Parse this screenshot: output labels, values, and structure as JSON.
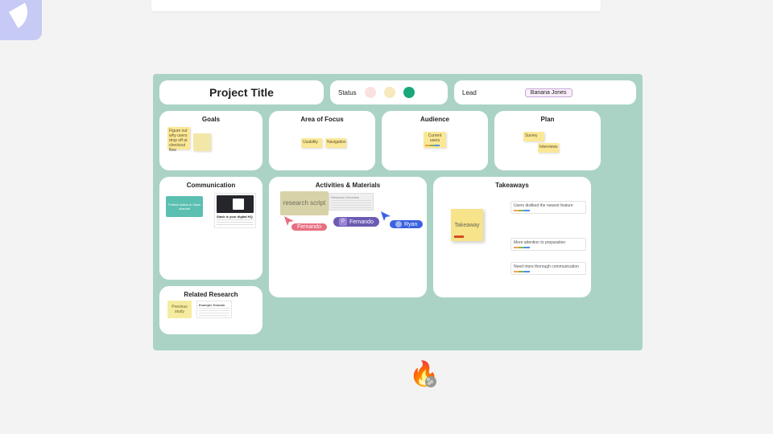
{
  "header": {
    "title": "Project Title",
    "status_label": "Status",
    "lead_label": "Lead",
    "lead_name": "Banana Jones"
  },
  "goals": {
    "heading": "Goals",
    "sticky_1": "Figure out why users drop off at checkout flow"
  },
  "focus": {
    "heading": "Area of Focus",
    "sticky_1": "Usability",
    "sticky_2": "Navigation"
  },
  "audience": {
    "heading": "Audience",
    "sticky_1": "Current users"
  },
  "plan": {
    "heading": "Plan",
    "sticky_1": "Survey",
    "sticky_2": "Interviews"
  },
  "communication": {
    "heading": "Communication",
    "teal_sticky": "Publish status in Slack channel",
    "thumb_caption": "Slack is your digital HQ"
  },
  "activities": {
    "heading": "Activities & Materials",
    "box_a": "research script",
    "box_b_title": "Research Overview",
    "name_pink": "Fernando",
    "name_purple": "Fernando",
    "name_purple_initial": "P",
    "name_blue": "Ryan"
  },
  "takeaways": {
    "heading": "Takeaways",
    "big_sticky": "Takeaway",
    "line1": "Users disliked the newest feature",
    "line2": "More attention to preparation",
    "line3": "Need more thorough communication"
  },
  "research": {
    "heading": "Related Research",
    "sticky": "Previous study",
    "doc_title": "Example Domain"
  },
  "colors": {
    "board_bg": "#abd3c5",
    "status_green": "#17a77a"
  }
}
